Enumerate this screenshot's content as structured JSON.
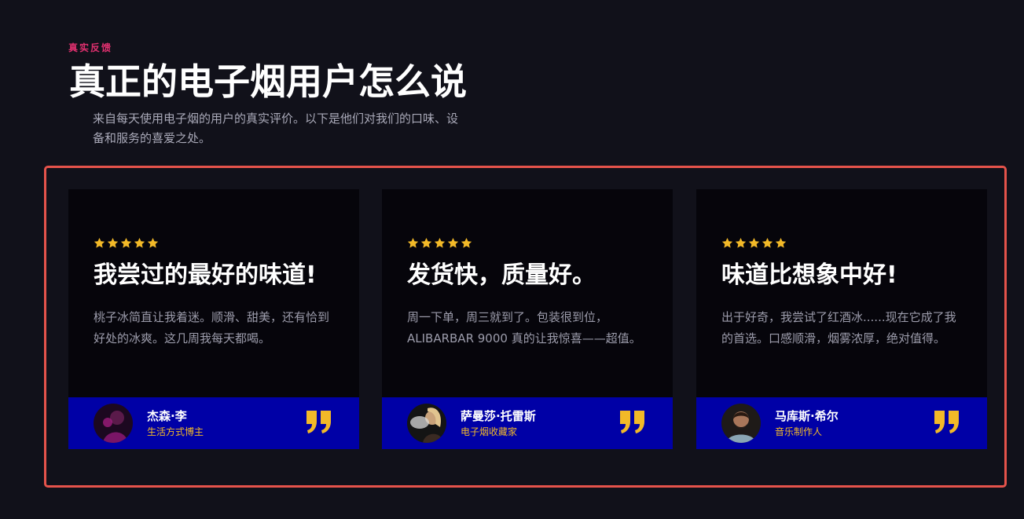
{
  "header": {
    "eyebrow": "真实反馈",
    "headline": "真正的电子烟用户怎么说",
    "subtitle": "来自每天使用电子烟的用户的真实评价。以下是他们对我们的口味、设备和服务的喜爱之处。"
  },
  "colors": {
    "accent_pink": "#e0306f",
    "footer_blue": "#0000a6",
    "star_gold": "#f2b928",
    "frame_red": "#e5534b"
  },
  "testimonials": [
    {
      "rating": 5,
      "title": "我尝过的最好的味道!",
      "text": "桃子冰简直让我着迷。顺滑、甜美，还有恰到好处的冰爽。这几周我每天都喝。",
      "author": "杰森·李",
      "role": "生活方式博主",
      "avatar_icon": "person-avatar-icon",
      "quote_icon": "quote-mark-icon"
    },
    {
      "rating": 5,
      "title": "发货快，质量好。",
      "text": "周一下单，周三就到了。包装很到位，ALIBARBAR 9000 真的让我惊喜——超值。",
      "author": "萨曼莎·托雷斯",
      "role": "电子烟收藏家",
      "avatar_icon": "person-avatar-icon",
      "quote_icon": "quote-mark-icon"
    },
    {
      "rating": 5,
      "title": "味道比想象中好!",
      "text": "出于好奇，我尝试了红酒冰......现在它成了我的首选。口感顺滑，烟雾浓厚，绝对值得。",
      "author": "马库斯·希尔",
      "role": "音乐制作人",
      "avatar_icon": "person-avatar-icon",
      "quote_icon": "quote-mark-icon"
    }
  ]
}
